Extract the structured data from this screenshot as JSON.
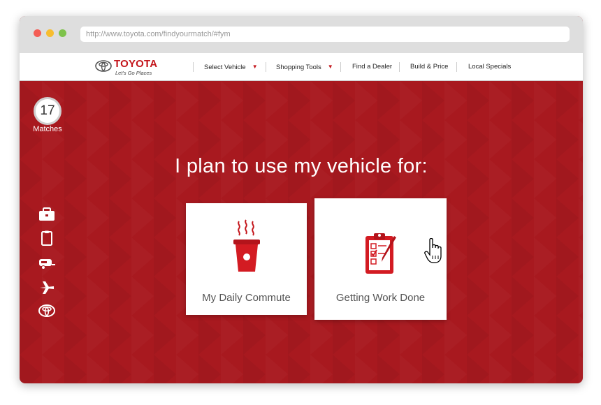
{
  "browser": {
    "url": "http://www.toyota.com/findyourmatch/#fym"
  },
  "brand": {
    "name": "TOYOTA",
    "tagline": "Let's Go Places",
    "color": "#c4161c"
  },
  "nav": {
    "items": [
      {
        "label": "Select Vehicle"
      },
      {
        "label": "Shopping Tools"
      },
      {
        "label": "Find a Dealer"
      },
      {
        "label": "Build & Price"
      },
      {
        "label": "Local Specials"
      }
    ]
  },
  "matches": {
    "count": "17",
    "label": "Matches"
  },
  "sidebar": {
    "icons": [
      "briefcase-icon",
      "clipboard-icon",
      "camper-trailer-icon",
      "airplane-icon",
      "toyota-logo-icon"
    ]
  },
  "main": {
    "heading": "I plan to use my vehicle for:",
    "options": [
      {
        "label": "My Daily Commute",
        "icon": "coffee-cup-icon"
      },
      {
        "label": "Getting Work Done",
        "icon": "checklist-clipboard-icon"
      }
    ]
  },
  "colors": {
    "background": "#a8191f",
    "accent": "#c4161c",
    "traffic_red": "#f45d55",
    "traffic_yellow": "#f7bd2f",
    "traffic_green": "#7ec24b"
  }
}
